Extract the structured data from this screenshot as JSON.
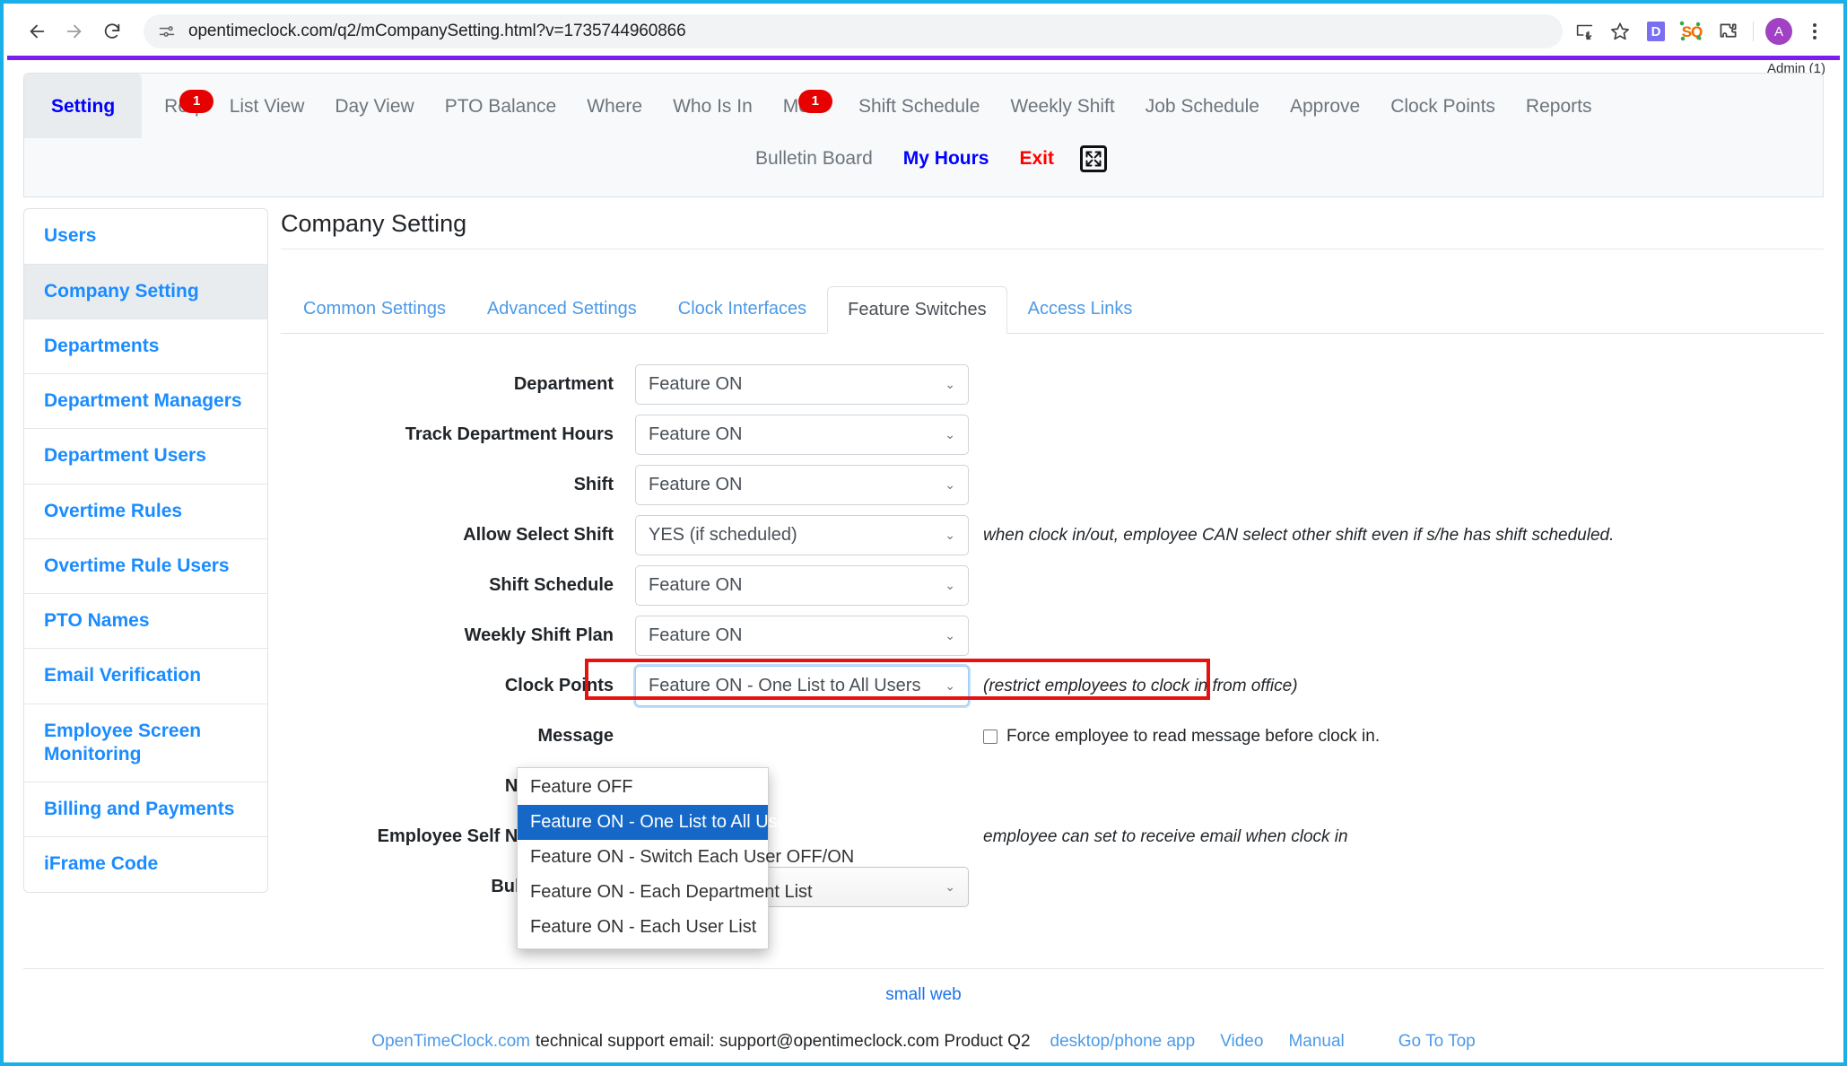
{
  "browser": {
    "url": "opentimeclock.com/q2/mCompanySetting.html?v=1735744960866",
    "back_icon": "back-arrow-icon",
    "forward_icon": "forward-arrow-icon",
    "reload_icon": "reload-icon",
    "site_info_icon": "site-settings-icon",
    "install_icon": "install-app-icon",
    "bookmark_icon": "star-icon",
    "ext1_label": "D",
    "ext2_label": "SQ",
    "puzzle_icon": "extensions-puzzle-icon",
    "avatar_letter": "A",
    "menu_icon": "three-dot-menu-icon"
  },
  "header": {
    "admin_label": "Admin (1)",
    "nav_primary": [
      {
        "label": "Setting",
        "active": true
      },
      {
        "label": "Req",
        "badge": "1"
      },
      {
        "label": "List View"
      },
      {
        "label": "Day View"
      },
      {
        "label": "PTO Balance"
      },
      {
        "label": "Where"
      },
      {
        "label": "Who Is In"
      },
      {
        "label": "Mess",
        "badge": "1"
      },
      {
        "label": "Shift Schedule"
      },
      {
        "label": "Weekly Shift"
      },
      {
        "label": "Job Schedule"
      },
      {
        "label": "Approve"
      },
      {
        "label": "Clock Points"
      },
      {
        "label": "Reports"
      }
    ],
    "nav_secondary": [
      {
        "label": "Bulletin Board",
        "style": "grey"
      },
      {
        "label": "My Hours",
        "style": "blue"
      },
      {
        "label": "Exit",
        "style": "red"
      }
    ],
    "expand_icon": "fullscreen-expand-icon"
  },
  "sidebar": {
    "items": [
      {
        "label": "Users",
        "active": false
      },
      {
        "label": "Company Setting",
        "active": true
      },
      {
        "label": "Departments",
        "active": false
      },
      {
        "label": "Department Managers",
        "active": false
      },
      {
        "label": "Department Users",
        "active": false
      },
      {
        "label": "Overtime Rules",
        "active": false
      },
      {
        "label": "Overtime Rule Users",
        "active": false
      },
      {
        "label": "PTO Names",
        "active": false
      },
      {
        "label": "Email Verification",
        "active": false
      },
      {
        "label": "Employee Screen Monitoring",
        "active": false
      },
      {
        "label": "Billing and Payments",
        "active": false
      },
      {
        "label": "iFrame Code",
        "active": false
      }
    ]
  },
  "main": {
    "page_title": "Company Setting",
    "tabs": [
      {
        "label": "Common Settings",
        "active": false
      },
      {
        "label": "Advanced Settings",
        "active": false
      },
      {
        "label": "Clock Interfaces",
        "active": false
      },
      {
        "label": "Feature Switches",
        "active": true
      },
      {
        "label": "Access Links",
        "active": false
      }
    ],
    "rows": [
      {
        "label": "Department",
        "value": "Feature ON",
        "hint": "",
        "style": "plain"
      },
      {
        "label": "Track Department Hours",
        "value": "Feature ON",
        "hint": "",
        "style": "plain"
      },
      {
        "label": "Shift",
        "value": "Feature ON",
        "hint": "",
        "style": "plain"
      },
      {
        "label": "Allow Select Shift",
        "value": "YES (if scheduled)",
        "hint": "when clock in/out, employee CAN select other shift even if s/he has shift scheduled.",
        "style": "plain"
      },
      {
        "label": "Shift Schedule",
        "value": "Feature ON",
        "hint": "",
        "style": "plain"
      },
      {
        "label": "Weekly Shift Plan",
        "value": "Feature ON",
        "hint": "",
        "style": "plain"
      },
      {
        "label": "Clock Points",
        "value": "Feature ON - One List to All Users",
        "hint": "(restrict employees to clock in from office)",
        "style": "focused"
      },
      {
        "label": "Message",
        "value": "",
        "hint": "",
        "style": "hidden",
        "checkbox_label": "Force employee to read message before clock in."
      },
      {
        "label": "Notifications",
        "value": "",
        "hint": "",
        "style": "hidden"
      },
      {
        "label": "Employee Self Notifications",
        "value": "",
        "hint": "employee can set to receive email when clock in",
        "style": "hidden"
      },
      {
        "label": "Bulletin Board",
        "value": "Feature ON",
        "hint": "",
        "style": "grey"
      }
    ],
    "dropdown": {
      "options": [
        {
          "label": "Feature OFF",
          "selected": false
        },
        {
          "label": "Feature ON - One List to All Users",
          "selected": true
        },
        {
          "label": "Feature ON - Switch Each User OFF/ON",
          "selected": false
        },
        {
          "label": "Feature ON - Each Department List",
          "selected": false
        },
        {
          "label": "Feature ON - Each User List",
          "selected": false
        }
      ]
    }
  },
  "footer": {
    "small_web": "small web",
    "brand": "OpenTimeClock.com",
    "support_text": "technical support email: support@opentimeclock.com Product Q2",
    "links": [
      {
        "label": "desktop/phone app"
      },
      {
        "label": "Video"
      },
      {
        "label": "Manual"
      }
    ],
    "go_to_top": "Go To Top"
  },
  "colors": {
    "accent_blue": "#1a8cff",
    "brand_purple": "#7a1ef0",
    "badge_red": "#e60000",
    "highlight_red": "#e81111",
    "selection_blue": "#1568c8",
    "browser_border": "#19b0e8"
  }
}
